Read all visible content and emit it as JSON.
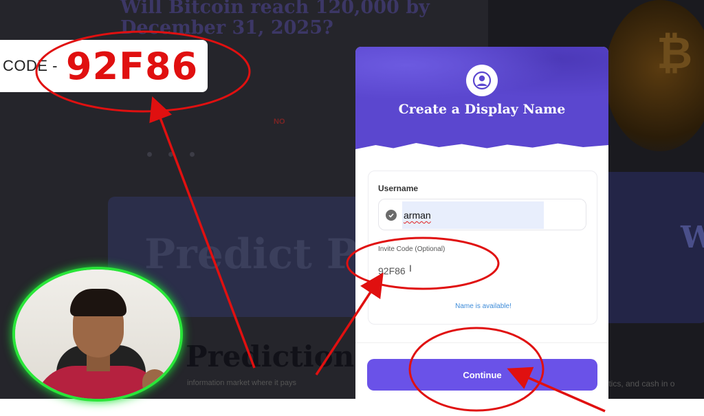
{
  "background": {
    "headline": "Will Bitcoin reach 120,000 by December 31, 2025?",
    "no_label": "NO",
    "banner_text": "Predict Poi",
    "predictions_heading": "Predictions In",
    "subtext_left": "information market where it pays",
    "subtext_right": "litics, and cash in o",
    "bitcoin_symbol": "₿",
    "right_glyph": "W"
  },
  "code_badge": {
    "label": "CODE -",
    "value": "92F86"
  },
  "modal": {
    "title": "Create a Display Name",
    "username_label": "Username",
    "username_value": "arman",
    "invite_label": "Invite Code (Optional)",
    "invite_value": "92F86",
    "availability": "Name is available!",
    "continue_label": "Continue"
  },
  "colors": {
    "accent": "#6a52e8",
    "header": "#5b47cf",
    "annotation_red": "#e01010",
    "cam_ring": "#29e639"
  },
  "icons": [
    "user-avatar-icon",
    "check-circle-icon",
    "text-cursor-icon"
  ]
}
